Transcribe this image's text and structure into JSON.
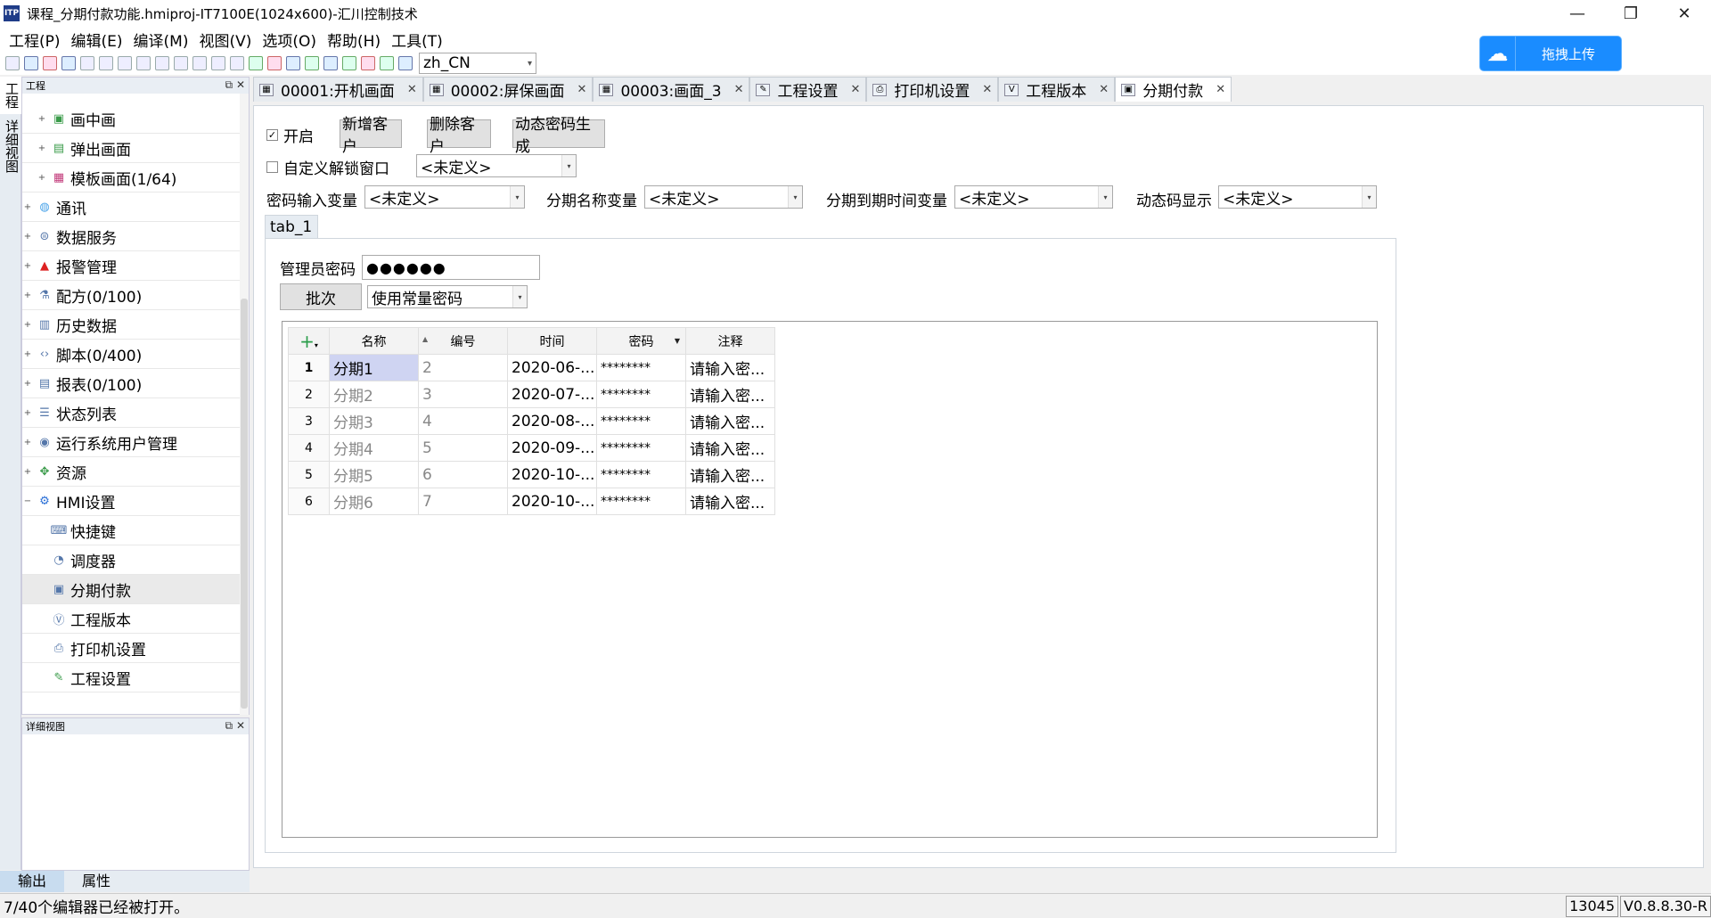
{
  "window": {
    "app_icon": "ITP",
    "title": "课程_分期付款功能.hmiproj-IT7100E(1024x600)-汇川控制技术",
    "buttons": [
      "—",
      "❐",
      "✕"
    ]
  },
  "menu": [
    "工程(P)",
    "编辑(E)",
    "编译(M)",
    "视图(V)",
    "选项(O)",
    "帮助(H)",
    "工具(T)"
  ],
  "toolbar": {
    "language": "zh_CN"
  },
  "upload": {
    "label": "拖拽上传",
    "icon": "cloud-icon"
  },
  "left_vtabs": [
    "工程",
    "详细视图"
  ],
  "project_panel": {
    "title": "工程",
    "items": [
      {
        "label": "画中画",
        "icon": "picture-icon",
        "level": 2
      },
      {
        "label": "弹出画面",
        "icon": "popup-icon",
        "level": 2
      },
      {
        "label": "模板画面(1/64)",
        "icon": "template-icon",
        "level": 2
      },
      {
        "label": "通讯",
        "icon": "globe-icon",
        "level": 1
      },
      {
        "label": "数据服务",
        "icon": "data-service-icon",
        "level": 1
      },
      {
        "label": "报警管理",
        "icon": "alarm-icon",
        "level": 1
      },
      {
        "label": "配方(0/100)",
        "icon": "flask-icon",
        "level": 1
      },
      {
        "label": "历史数据",
        "icon": "history-icon",
        "level": 1
      },
      {
        "label": "脚本(0/400)",
        "icon": "script-icon",
        "level": 1
      },
      {
        "label": "报表(0/100)",
        "icon": "report-icon",
        "level": 1
      },
      {
        "label": "状态列表",
        "icon": "status-list-icon",
        "level": 1
      },
      {
        "label": "运行系统用户管理",
        "icon": "user-icon",
        "level": 1
      },
      {
        "label": "资源",
        "icon": "resource-icon",
        "level": 1
      },
      {
        "label": "HMI设置",
        "icon": "gear-icon",
        "level": 1
      },
      {
        "label": "快捷键",
        "icon": "keyboard-icon",
        "level": 2
      },
      {
        "label": "调度器",
        "icon": "scheduler-icon",
        "level": 2
      },
      {
        "label": "分期付款",
        "icon": "installment-icon",
        "level": 2,
        "selected": true
      },
      {
        "label": "工程版本",
        "icon": "version-icon",
        "level": 2
      },
      {
        "label": "打印机设置",
        "icon": "printer-icon",
        "level": 2
      },
      {
        "label": "工程设置",
        "icon": "wrench-icon",
        "level": 2
      }
    ]
  },
  "detail_panel": {
    "title": "详细视图"
  },
  "bottom_tabs": [
    "输出",
    "属性"
  ],
  "status": {
    "message": "7/40个编辑器已经被打开。",
    "cell1": "13045",
    "cell2": "V0.8.8.30-R"
  },
  "doc_tabs": [
    {
      "label": "00001:开机画面",
      "icon": "screen-icon"
    },
    {
      "label": "00002:屏保画面",
      "icon": "screen-icon"
    },
    {
      "label": "00003:画面_3",
      "icon": "screen-icon"
    },
    {
      "label": "工程设置",
      "icon": "wrench-icon"
    },
    {
      "label": "打印机设置",
      "icon": "printer-icon"
    },
    {
      "label": "工程版本",
      "icon": "version-icon"
    },
    {
      "label": "分期付款",
      "icon": "installment-icon",
      "active": true
    }
  ],
  "editor": {
    "enable_label": "开启",
    "enable_checked": true,
    "add_customer": "新增客户",
    "delete_customer": "删除客户",
    "dynamic_pwd": "动态密码生成",
    "custom_unlock_label": "自定义解锁窗口",
    "custom_unlock_checked": false,
    "custom_unlock_value": "<未定义>",
    "pwd_var_label": "密码输入变量",
    "pwd_var_value": "<未定义>",
    "name_var_label": "分期名称变量",
    "name_var_value": "<未定义>",
    "due_var_label": "分期到期时间变量",
    "due_var_value": "<未定义>",
    "dyncode_label": "动态码显示",
    "dyncode_value": "<未定义>",
    "tab_label": "tab_1",
    "admin_pwd_label": "管理员密码",
    "admin_pwd_value": "●●●●●●",
    "batch_button": "批次",
    "pwd_mode": "使用常量密码"
  },
  "grid": {
    "headers": [
      "名称",
      "编号",
      "时间",
      "密码",
      "注释"
    ],
    "rows": [
      {
        "n": "1",
        "name": "分期1",
        "num": "2",
        "time": "2020-06-...",
        "pwd": "********",
        "note": "请输入密..."
      },
      {
        "n": "2",
        "name": "分期2",
        "num": "3",
        "time": "2020-07-...",
        "pwd": "********",
        "note": "请输入密..."
      },
      {
        "n": "3",
        "name": "分期3",
        "num": "4",
        "time": "2020-08-...",
        "pwd": "********",
        "note": "请输入密..."
      },
      {
        "n": "4",
        "name": "分期4",
        "num": "5",
        "time": "2020-09-...",
        "pwd": "********",
        "note": "请输入密..."
      },
      {
        "n": "5",
        "name": "分期5",
        "num": "6",
        "time": "2020-10-...",
        "pwd": "********",
        "note": "请输入密..."
      },
      {
        "n": "6",
        "name": "分期6",
        "num": "7",
        "time": "2020-10-...",
        "pwd": "********",
        "note": "请输入密..."
      }
    ]
  }
}
